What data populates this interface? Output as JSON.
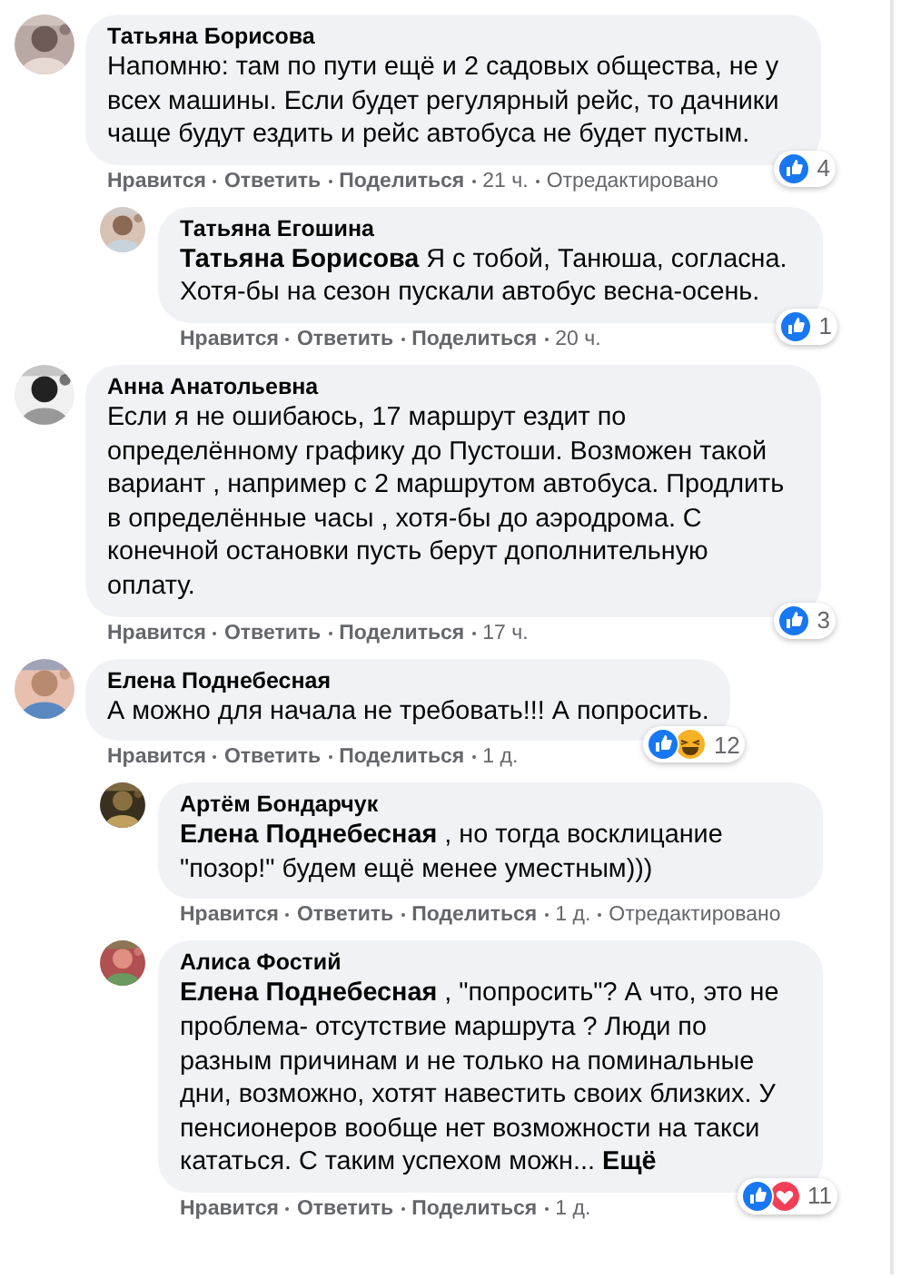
{
  "comments": [
    {
      "author": "Татьяна Борисова",
      "text": "Напомню: там по пути ещё и 2 садовых общества, не у всех машины. Если будет регулярный рейс, то дачники чаще будут ездить и рейс автобуса не будет пустым.",
      "reactions": {
        "icons": [
          {
            "kind": "like"
          }
        ],
        "count": "4"
      },
      "actions": {
        "like": "Нравится",
        "reply": "Ответить",
        "share": "Поделиться",
        "time": "21 ч.",
        "edited": "Отредактировано"
      },
      "children": [
        {
          "author": "Татьяна Егошина",
          "text": "**Татьяна Борисова** Я с тобой, Танюша, согласна. Хотя-бы на сезон пускали автобус весна-осень.",
          "reactions": {
            "icons": [
              {
                "kind": "like"
              }
            ],
            "count": "1"
          },
          "actions": {
            "like": "Нравится",
            "reply": "Ответить",
            "share": "Поделиться",
            "time": "20 ч."
          }
        }
      ]
    },
    {
      "author": "Анна Анатольевна",
      "text": "Если я не ошибаюсь, 17 маршрут ездит по определённому графику до Пустоши. Возможен такой вариант , например с 2 маршрутом автобуса. Продлить в определённые часы , хотя-бы до аэродрома. С конечной остановки пусть берут дополнительную оплату.",
      "reactions": {
        "icons": [
          {
            "kind": "like"
          }
        ],
        "count": "3"
      },
      "actions": {
        "like": "Нравится",
        "reply": "Ответить",
        "share": "Поделиться",
        "time": "17 ч."
      }
    },
    {
      "author": "Елена Поднебесная",
      "text": "А можно для начала не требовать!!! А попросить.",
      "reactions": {
        "icons": [
          {
            "kind": "like"
          },
          {
            "kind": "haha"
          }
        ],
        "count": "12"
      },
      "actions": {
        "like": "Нравится",
        "reply": "Ответить",
        "share": "Поделиться",
        "time": "1 д."
      },
      "children": [
        {
          "author": "Артём Бондарчук",
          "text": "**Елена Поднебесная** , но тогда восклицание \"позор!\" будем ещё менее уместным)))",
          "actions": {
            "like": "Нравится",
            "reply": "Ответить",
            "share": "Поделиться",
            "time": "1 д.",
            "edited": "Отредактировано"
          }
        },
        {
          "author": "Алиса Фостий",
          "text": "**Елена Поднебесная** , \"попросить\"? А что, это не проблема- отсутствие маршрута ? Люди по разным причинам и не только на поминальные дни, возможно, хотят навестить своих близких. У пенсионеров вообще нет возможности на такси кататься. С таким успехом можн...",
          "more": "Ещё",
          "reactions": {
            "icons": [
              {
                "kind": "like"
              },
              {
                "kind": "love"
              }
            ],
            "count": "11"
          },
          "actions": {
            "like": "Нравится",
            "reply": "Ответить",
            "share": "Поделиться",
            "time": "1 д."
          }
        }
      ]
    }
  ]
}
